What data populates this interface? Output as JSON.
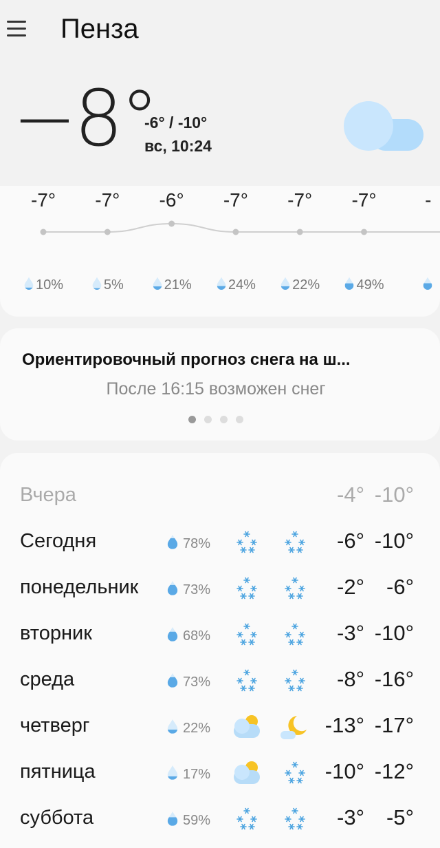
{
  "header": {
    "city": "Пенза",
    "menu_icon": "hamburger-menu-icon"
  },
  "current": {
    "temp": "−8°",
    "hilo": "-6° / -10°",
    "daytime": "вс, 10:24",
    "icon": "cloudy-icon"
  },
  "hourly": [
    {
      "temp": "-7°",
      "value": -7,
      "precip": "10%",
      "fill": 0.1
    },
    {
      "temp": "-7°",
      "value": -7,
      "precip": "5%",
      "fill": 0.05
    },
    {
      "temp": "-6°",
      "value": -6,
      "precip": "21%",
      "fill": 0.21
    },
    {
      "temp": "-7°",
      "value": -7,
      "precip": "24%",
      "fill": 0.24
    },
    {
      "temp": "-7°",
      "value": -7,
      "precip": "22%",
      "fill": 0.22
    },
    {
      "temp": "-7°",
      "value": -7,
      "precip": "49%",
      "fill": 0.49
    },
    {
      "temp": "-",
      "value": -7,
      "precip": "",
      "fill": 0.5
    }
  ],
  "snow_card": {
    "title": "Ориентировочный прогноз снега на ш...",
    "subtitle": "После 16:15 возможен снег",
    "pages": 4,
    "active_page": 1
  },
  "daily": [
    {
      "name": "Вчера",
      "precip": "",
      "day_icon": "",
      "night_icon": "",
      "hi": "-4°",
      "lo": "-10°",
      "past": true
    },
    {
      "name": "Сегодня",
      "precip": "78%",
      "fill": 0.78,
      "day_icon": "snow",
      "night_icon": "snow",
      "hi": "-6°",
      "lo": "-10°"
    },
    {
      "name": "понедельник",
      "precip": "73%",
      "fill": 0.73,
      "day_icon": "snow",
      "night_icon": "snow",
      "hi": "-2°",
      "lo": "-6°"
    },
    {
      "name": "вторник",
      "precip": "68%",
      "fill": 0.68,
      "day_icon": "snow",
      "night_icon": "snow",
      "hi": "-3°",
      "lo": "-10°"
    },
    {
      "name": "среда",
      "precip": "73%",
      "fill": 0.73,
      "day_icon": "snow",
      "night_icon": "snow",
      "hi": "-8°",
      "lo": "-16°"
    },
    {
      "name": "четверг",
      "precip": "22%",
      "fill": 0.22,
      "day_icon": "partly-cloudy-day",
      "night_icon": "partly-cloudy-night",
      "hi": "-13°",
      "lo": "-17°"
    },
    {
      "name": "пятница",
      "precip": "17%",
      "fill": 0.17,
      "day_icon": "partly-cloudy-day",
      "night_icon": "snow",
      "hi": "-10°",
      "lo": "-12°"
    },
    {
      "name": "суббота",
      "precip": "59%",
      "fill": 0.59,
      "day_icon": "snow",
      "night_icon": "snow",
      "hi": "-3°",
      "lo": "-5°"
    }
  ],
  "colors": {
    "drop": "#5aa9e6",
    "cloud": "#b7dcf8",
    "sun": "#f7c325",
    "snow": "#4aa3e0"
  }
}
